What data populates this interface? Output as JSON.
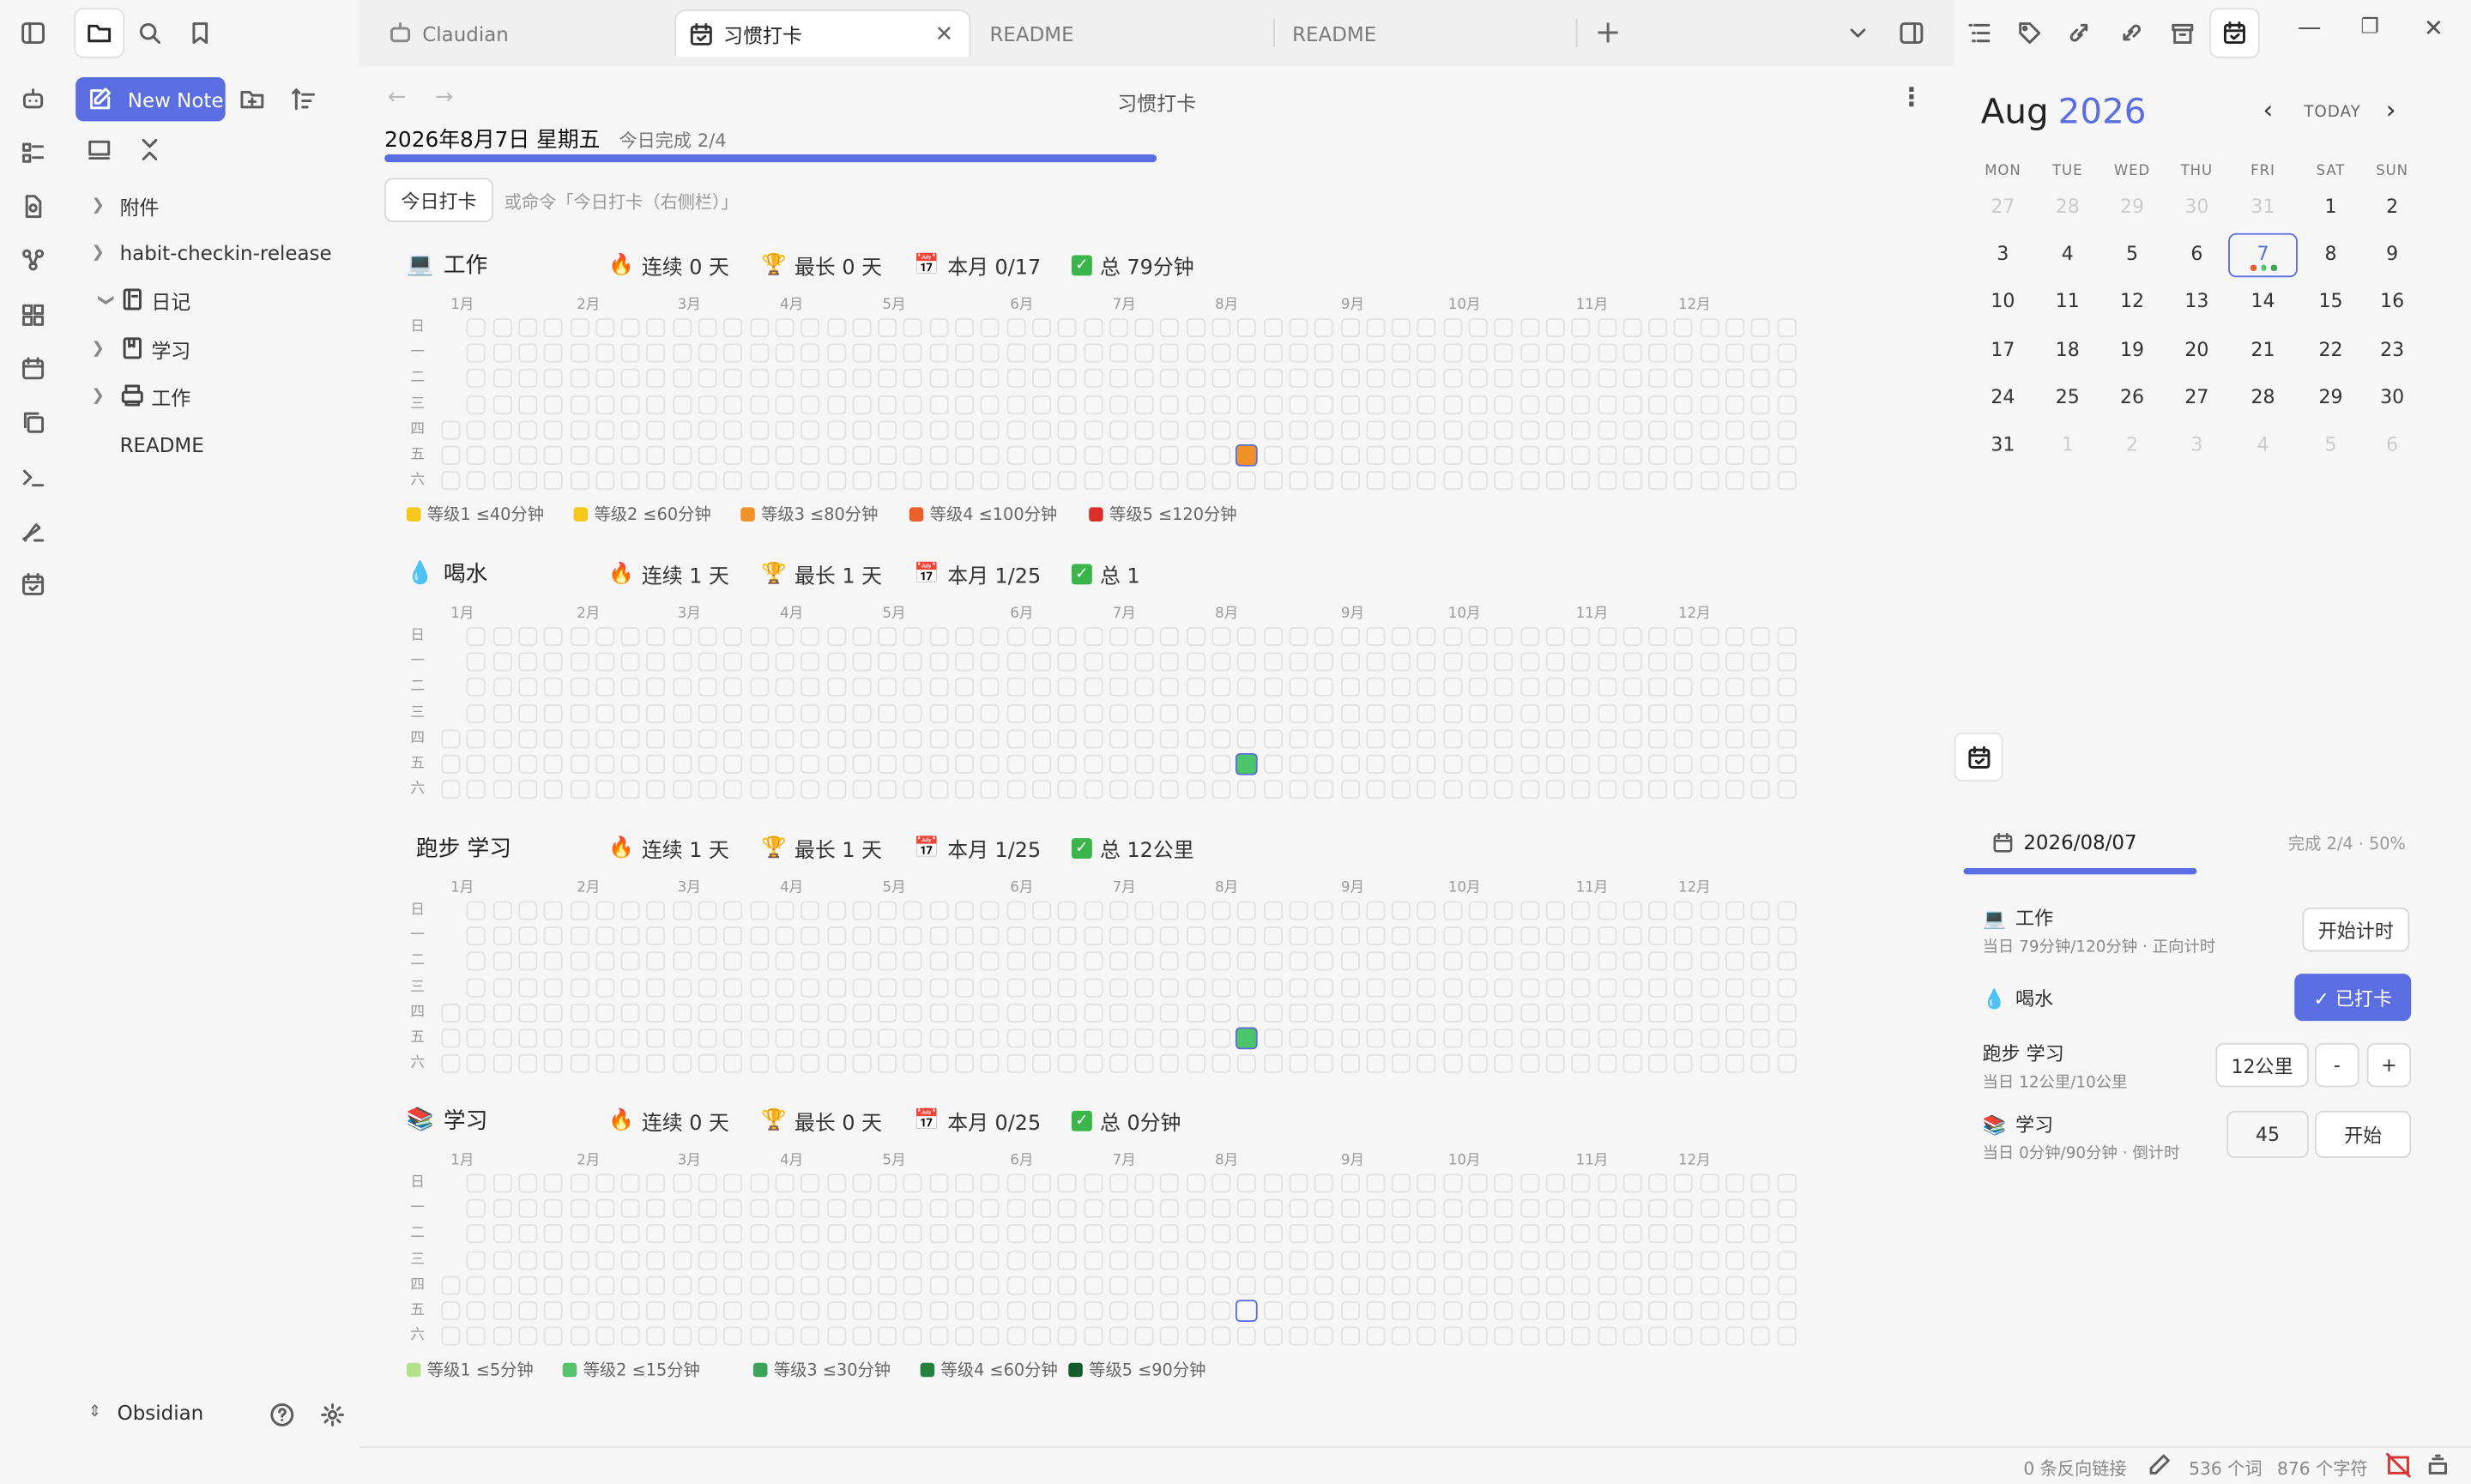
{
  "tabs": [
    {
      "label": "Claudian"
    },
    {
      "label": "习惯打卡"
    },
    {
      "label": "README"
    },
    {
      "label": "README"
    }
  ],
  "sidebar": {
    "new_note": "New Note",
    "items": [
      {
        "label": "附件"
      },
      {
        "label": "habit-checkin-release"
      },
      {
        "label": "日记"
      },
      {
        "label": "学习"
      },
      {
        "label": "工作"
      },
      {
        "label": "README"
      }
    ],
    "vault": "Obsidian"
  },
  "main": {
    "view_title": "习惯打卡",
    "date_line": "2026年8月7日 星期五",
    "done_today": "今日完成 2/4",
    "progress": 0.5,
    "checkin_button": "今日打卡",
    "hint": "或命令「今日打卡（右侧栏）」",
    "months": [
      "1月",
      "2月",
      "3月",
      "4月",
      "5月",
      "6月",
      "7月",
      "8月",
      "9月",
      "10月",
      "11月",
      "12月"
    ],
    "weekdays": [
      "日",
      "一",
      "二",
      "三",
      "四",
      "五",
      "六"
    ],
    "habits": [
      {
        "icon": "💻",
        "name": "工作",
        "streak": "连续 0 天",
        "best": "最长 0 天",
        "month": "本月 0/17",
        "total": "总 79分钟",
        "today_color": "#f0912a"
      },
      {
        "icon": "💧",
        "name": "喝水",
        "streak": "连续 1 天",
        "best": "最长 1 天",
        "month": "本月 1/25",
        "total": "总 1",
        "today_color": "#4cc46a"
      },
      {
        "icon": "",
        "name": "跑步 学习",
        "streak": "连续 1 天",
        "best": "最长 1 天",
        "month": "本月 1/25",
        "total": "总 12公里",
        "today_color": "#4cc46a"
      },
      {
        "icon": "📚",
        "name": "学习",
        "streak": "连续 0 天",
        "best": "最长 0 天",
        "month": "本月 0/25",
        "total": "总 0分钟",
        "today_color": ""
      }
    ],
    "legend_warm": [
      {
        "label": "等级1 ≤40分钟",
        "color": "#f4c81d"
      },
      {
        "label": "等级2 ≤60分钟",
        "color": "#f4c81d"
      },
      {
        "label": "等级3 ≤80分钟",
        "color": "#f0912a"
      },
      {
        "label": "等级4 ≤100分钟",
        "color": "#e8612c"
      },
      {
        "label": "等级5 ≤120分钟",
        "color": "#d9302c"
      }
    ],
    "legend_green": [
      {
        "label": "等级1 ≤5分钟",
        "color": "#b7e08a"
      },
      {
        "label": "等级2 ≤15分钟",
        "color": "#56c26a"
      },
      {
        "label": "等级3 ≤30分钟",
        "color": "#3ea35a"
      },
      {
        "label": "等级4 ≤60分钟",
        "color": "#24803f"
      },
      {
        "label": "等级5 ≤90分钟",
        "color": "#145a2b"
      }
    ]
  },
  "calendar": {
    "month": "Aug",
    "year": "2026",
    "today": "TODAY",
    "headers": [
      "MON",
      "TUE",
      "WED",
      "THU",
      "FRI",
      "SAT",
      "SUN"
    ],
    "weeks": [
      [
        "27",
        "28",
        "29",
        "30",
        "31",
        "1",
        "2"
      ],
      [
        "3",
        "4",
        "5",
        "6",
        "7",
        "8",
        "9"
      ],
      [
        "10",
        "11",
        "12",
        "13",
        "14",
        "15",
        "16"
      ],
      [
        "17",
        "18",
        "19",
        "20",
        "21",
        "22",
        "23"
      ],
      [
        "24",
        "25",
        "26",
        "27",
        "28",
        "29",
        "30"
      ],
      [
        "31",
        "1",
        "2",
        "3",
        "4",
        "5",
        "6"
      ]
    ]
  },
  "panel": {
    "date": "2026/08/07",
    "summary": "完成 2/4 · 50%",
    "progress": 0.5,
    "rows": [
      {
        "icon": "💻",
        "name": "工作",
        "sub": "当日 79分钟/120分钟 · 正向计时",
        "action": "开始计时"
      },
      {
        "icon": "💧",
        "name": "喝水",
        "sub": "",
        "action": "✓ 已打卡"
      },
      {
        "icon": "",
        "name": "跑步 学习",
        "sub": "当日 12公里/10公里",
        "value": "12公里",
        "minus": "-",
        "plus": "+"
      },
      {
        "icon": "📚",
        "name": "学习",
        "sub": "当日 0分钟/90分钟 · 倒计时",
        "value": "45",
        "action": "开始"
      }
    ]
  },
  "status": {
    "backlinks": "0 条反向链接",
    "words": "536 个词",
    "chars": "876 个字符"
  },
  "colors": {
    "accent": "#5b6ee1"
  }
}
